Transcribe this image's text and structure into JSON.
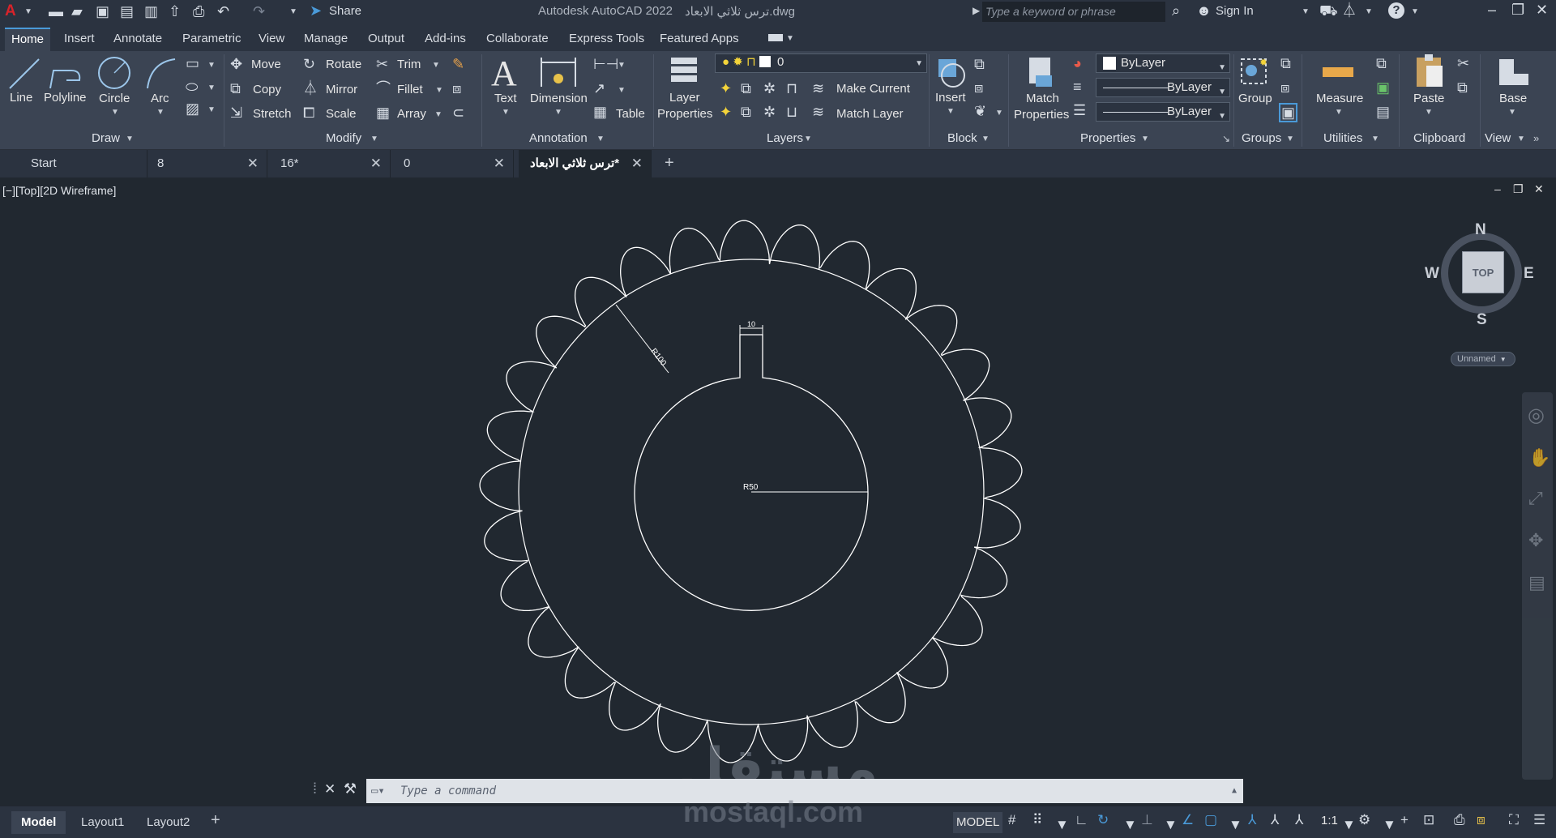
{
  "app": {
    "title": "Autodesk AutoCAD 2022",
    "filename": "ترس ثلاثي الابعاد.dwg",
    "share_label": "Share",
    "search_placeholder": "Type a keyword or phrase",
    "sign_in": "Sign In"
  },
  "ribbon_tabs": [
    "Home",
    "Insert",
    "Annotate",
    "Parametric",
    "View",
    "Manage",
    "Output",
    "Add-ins",
    "Collaborate",
    "Express Tools",
    "Featured Apps"
  ],
  "draw": {
    "line": "Line",
    "polyline": "Polyline",
    "circle": "Circle",
    "arc": "Arc",
    "label": "Draw"
  },
  "modify": {
    "move": "Move",
    "rotate": "Rotate",
    "trim": "Trim",
    "copy": "Copy",
    "mirror": "Mirror",
    "fillet": "Fillet",
    "stretch": "Stretch",
    "scale": "Scale",
    "array": "Array",
    "label": "Modify"
  },
  "annotation": {
    "text": "Text",
    "dimension": "Dimension",
    "table": "Table",
    "label": "Annotation"
  },
  "layers": {
    "layer_properties_1": "Layer",
    "layer_properties_2": "Properties",
    "current_layer": "0",
    "make_current": "Make Current",
    "match_layer": "Match Layer",
    "label": "Layers"
  },
  "block": {
    "insert": "Insert",
    "label": "Block"
  },
  "properties": {
    "match_1": "Match",
    "match_2": "Properties",
    "color": "ByLayer",
    "linetype": "ByLayer",
    "lineweight": "ByLayer",
    "label": "Properties"
  },
  "groups": {
    "group": "Group",
    "label": "Groups"
  },
  "utilities": {
    "measure": "Measure",
    "label": "Utilities"
  },
  "clipboard": {
    "paste": "Paste",
    "label": "Clipboard"
  },
  "view": {
    "base": "Base",
    "label": "View"
  },
  "file_tabs": [
    {
      "label": "Start"
    },
    {
      "label": "8"
    },
    {
      "label": "16*"
    },
    {
      "label": "0"
    },
    {
      "label": "ترس ثلاثي الابعاد*"
    }
  ],
  "viewport": {
    "label": "[−][Top][2D Wireframe]",
    "dims": {
      "r100": "R100",
      "r50": "R50",
      "width10": "10"
    },
    "gear": {
      "teeth": 29
    }
  },
  "viewcube": {
    "n": "N",
    "s": "S",
    "e": "E",
    "w": "W",
    "top": "TOP",
    "ucs": "Unnamed"
  },
  "command": {
    "placeholder": "Type a command"
  },
  "layout_tabs": [
    "Model",
    "Layout1",
    "Layout2"
  ],
  "status": {
    "model": "MODEL",
    "scale": "1:1"
  },
  "watermark": {
    "arabic": "مستقل",
    "latin": "mostaql.com"
  },
  "colors": {
    "accent": "#4a9ad8",
    "background": "#212830",
    "ribbon": "#3b4453"
  }
}
